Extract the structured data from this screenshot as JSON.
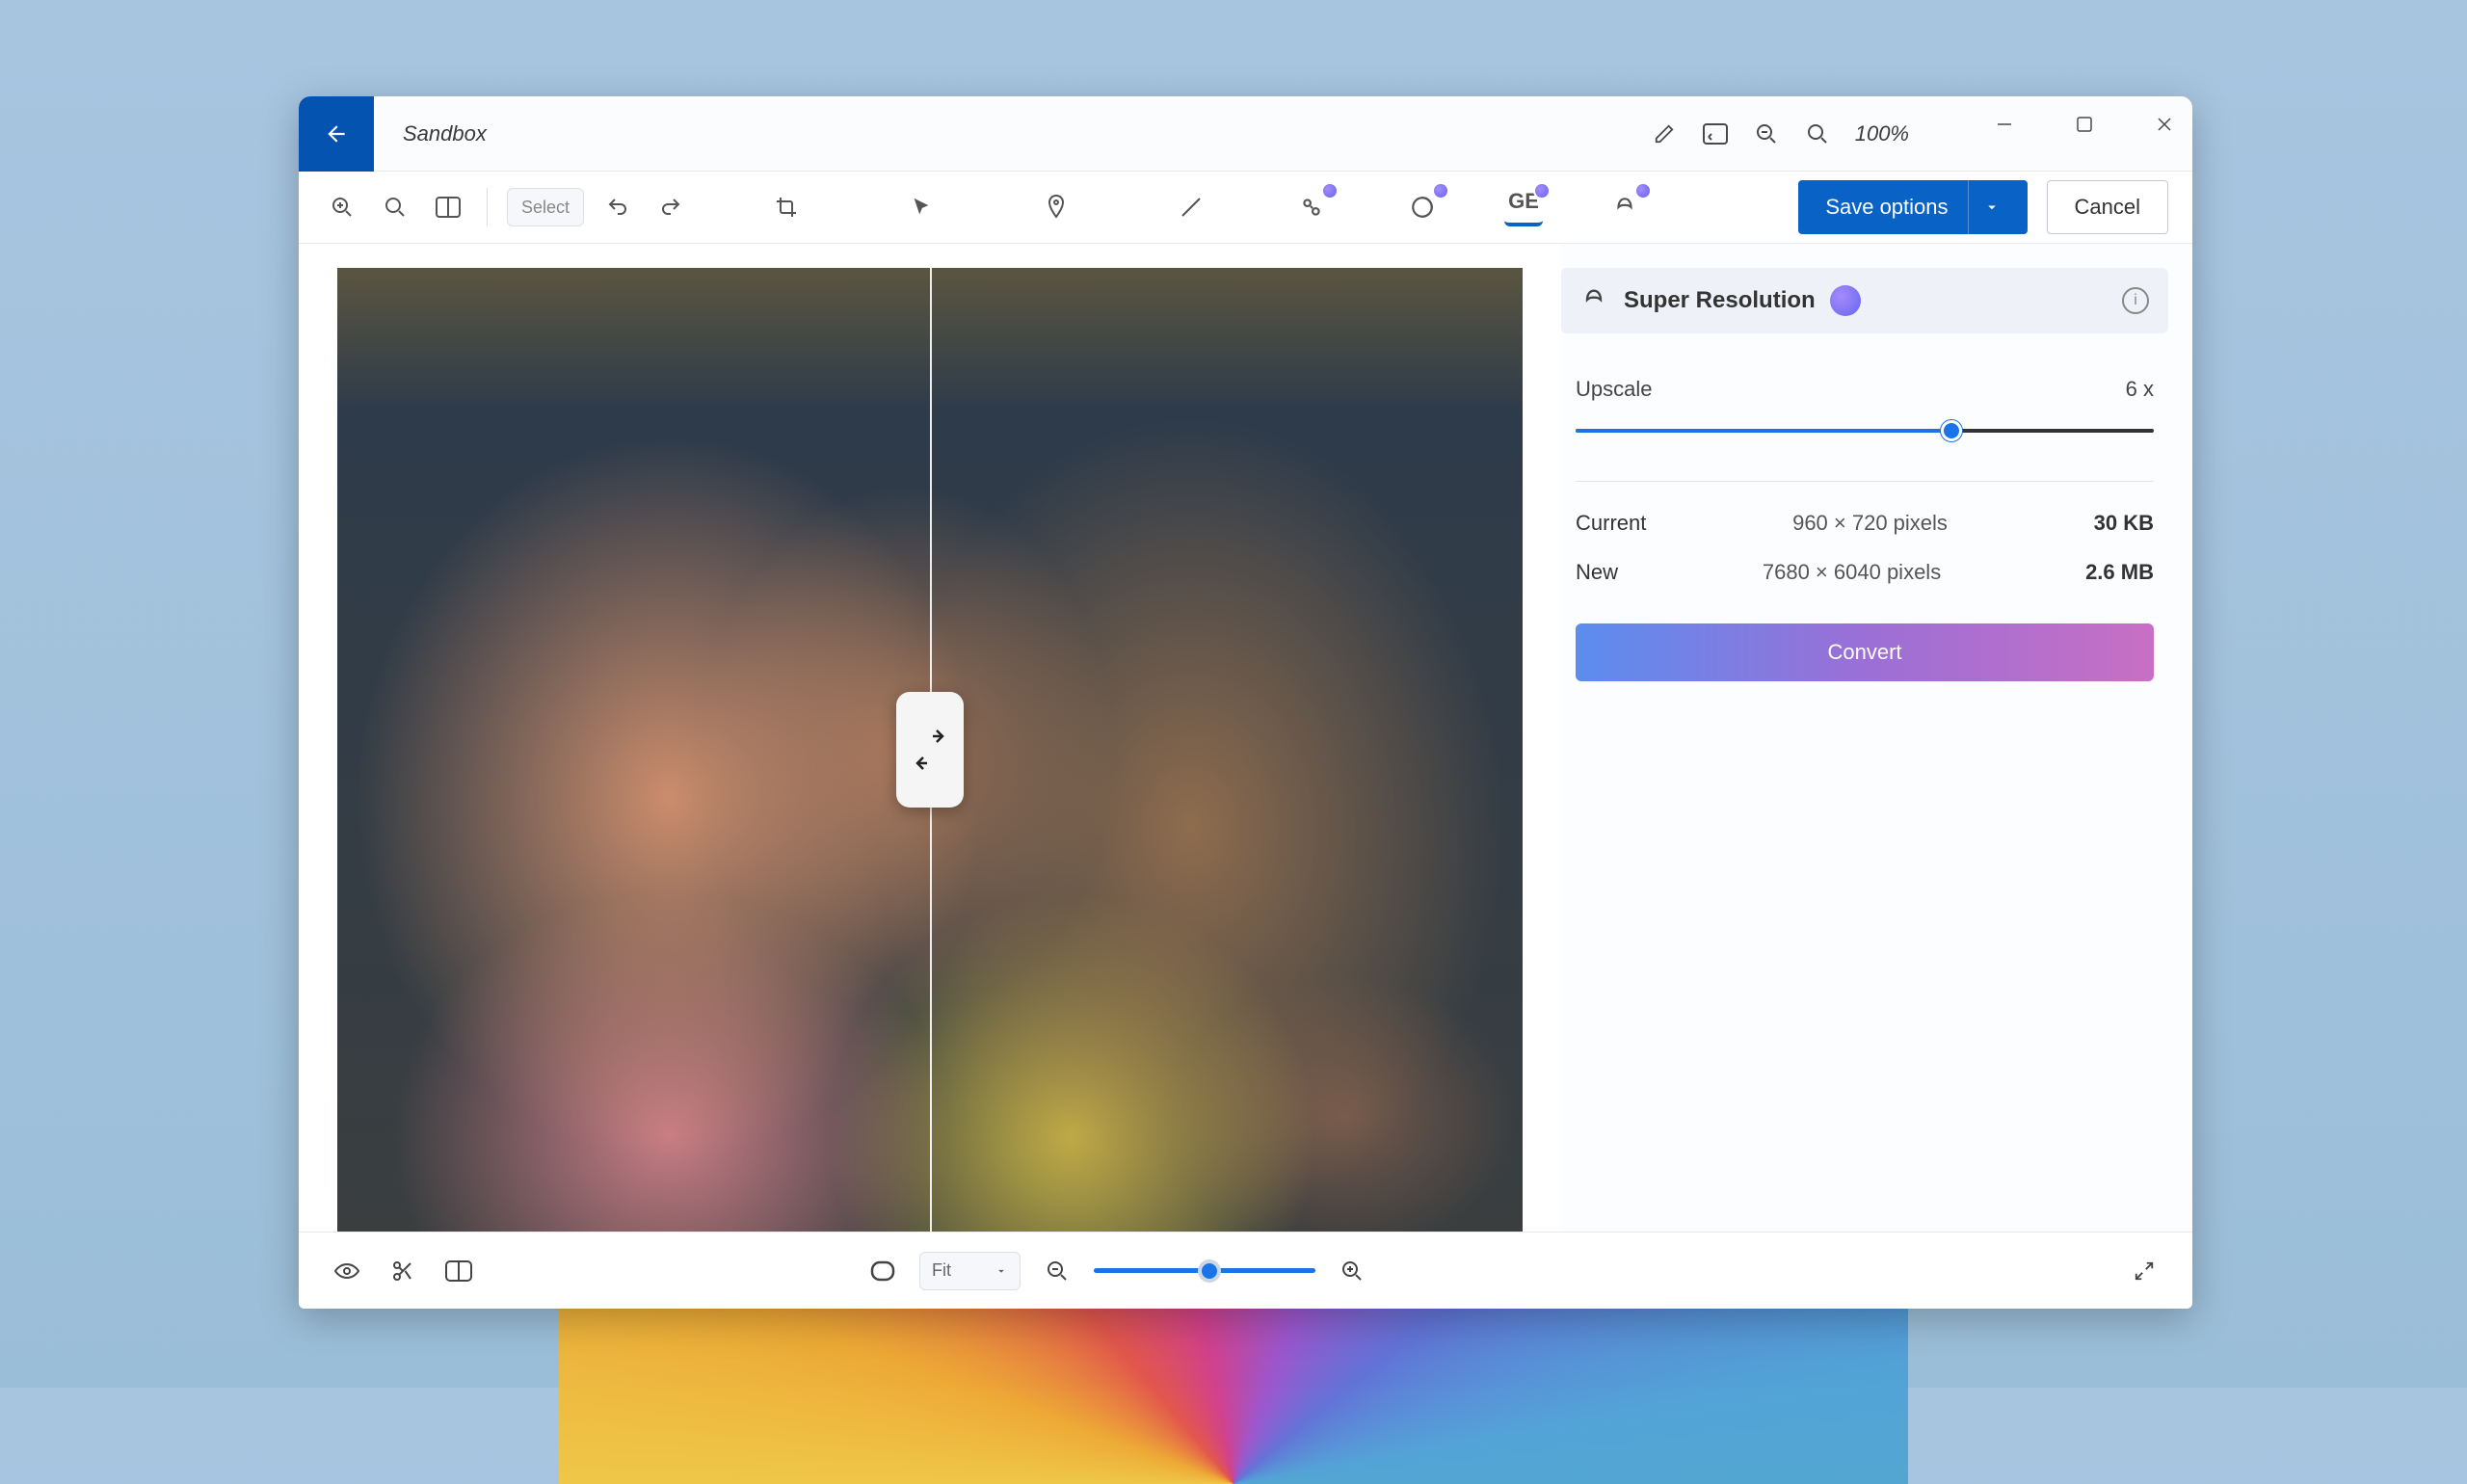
{
  "header": {
    "title": "Sandbox",
    "zoom_label": "100%"
  },
  "toolbar": {
    "selection_label": "Select",
    "save_label": "Save options",
    "cancel_label": "Cancel"
  },
  "panel": {
    "title": "Super Resolution",
    "slider_label": "Upscale",
    "slider_value": "6 x",
    "current_label": "Current",
    "current_res": "960 × 720 pixels",
    "current_size": "30 KB",
    "new_label": "New",
    "new_res": "7680 × 6040 pixels",
    "new_size": "2.6 MB",
    "try_label": "Convert"
  },
  "bottombar": {
    "zoom_value": "Fit"
  }
}
